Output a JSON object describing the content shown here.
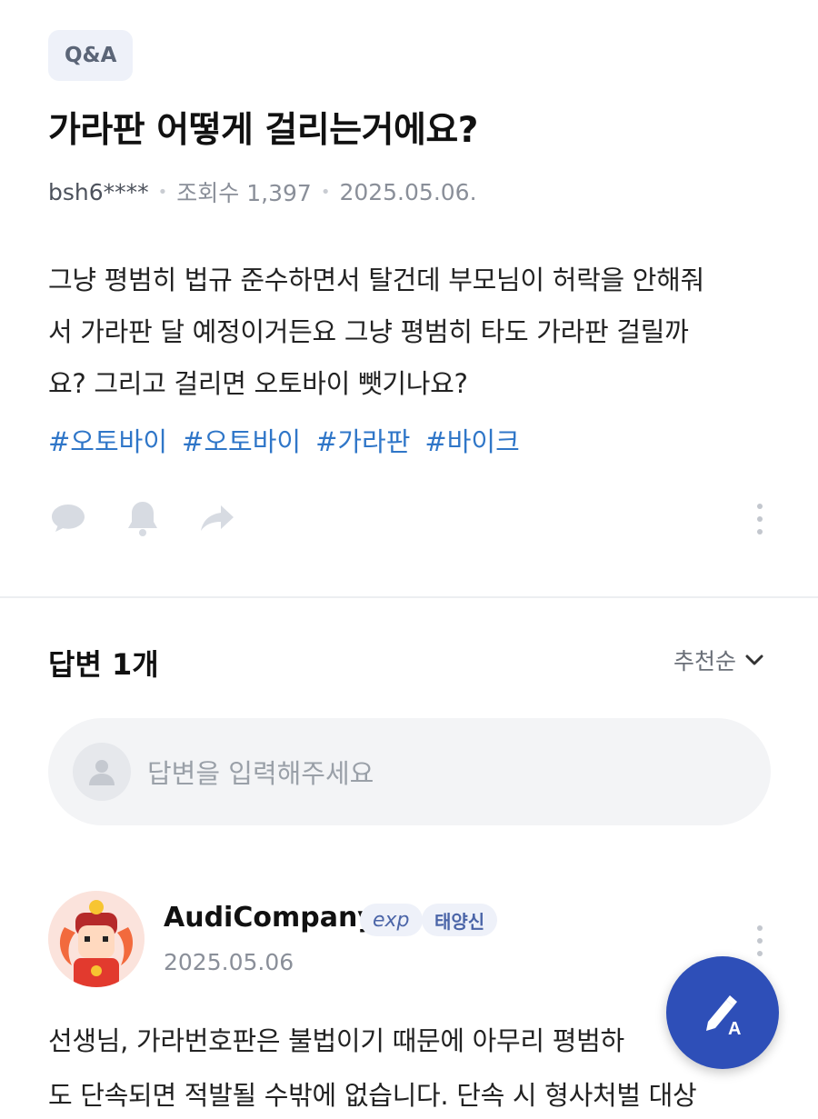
{
  "question": {
    "badge": "Q&A",
    "title": "가라판 어떻게 걸리는거에요?",
    "author": "bsh6****",
    "views": "조회수 1,397",
    "date": "2025.05.06.",
    "body_lines": [
      "그냥 평범히 법규 준수하면서 탈건데 부모님이 허락을 안해줘",
      "서 가라판 달 예정이거든요 그냥 평범히 타도 가라판 걸릴까",
      "요? 그리고 걸리면 오토바이 뺏기나요?"
    ],
    "tags": [
      "#오토바이",
      "#오토바이",
      "#가라판",
      "#바이크"
    ],
    "icons": [
      "comment-icon",
      "bell-icon",
      "share-icon",
      "more-vertical-icon"
    ]
  },
  "answers": {
    "title": "답변 1개",
    "sort_label": "추천순",
    "input_placeholder": "답변을 입력해주세요"
  },
  "answer": {
    "name": "AudiCompany",
    "exp_badge": "exp",
    "rank_badge": "태양신",
    "date": "2025.05.06",
    "text_lines": [
      "선생님, 가라번호판은 불법이기 때문에 아무리 평범하",
      "도 단속되면 적발될 수밖에 없습니다. 단속 시 형사처벌 대상"
    ]
  },
  "colors": {
    "tag": "#2f76c8",
    "fab": "#2e4fb8",
    "badge_bg": "#eef1f9"
  }
}
